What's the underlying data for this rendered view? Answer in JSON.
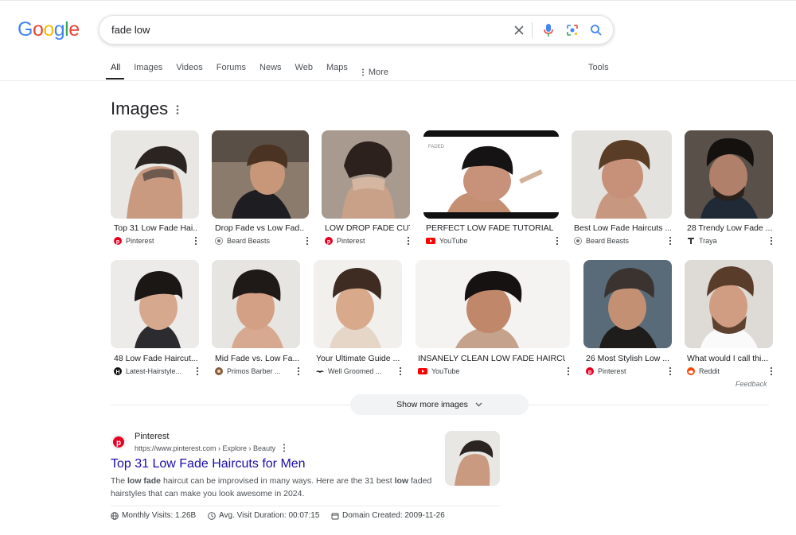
{
  "logo": {
    "text": "Google",
    "letters": [
      "G",
      "o",
      "o",
      "g",
      "l",
      "e"
    ],
    "colors": [
      "#4285F4",
      "#EA4335",
      "#FBBC05",
      "#4285F4",
      "#34A853",
      "#EA4335"
    ]
  },
  "search": {
    "query": "fade low"
  },
  "tabs": [
    "All",
    "Images",
    "Videos",
    "Forums",
    "News",
    "Web",
    "Maps",
    "More"
  ],
  "tools_label": "Tools",
  "images": {
    "title": "Images",
    "row1": [
      {
        "caption": "Top 31 Low Fade Hai...",
        "source": "Pinterest",
        "source_icon": "pinterest-icon"
      },
      {
        "caption": "Drop Fade vs Low Fad...",
        "source": "Beard Beasts",
        "source_icon": "beard-beasts-icon"
      },
      {
        "caption": "LOW DROP FADE CUT",
        "source": "Pinterest",
        "source_icon": "pinterest-icon"
      },
      {
        "caption": "PERFECT LOW FADE TUTORIAL, ...",
        "source": "YouTube",
        "source_icon": "youtube-icon"
      },
      {
        "caption": "Best Low Fade Haircuts ...",
        "source": "Beard Beasts",
        "source_icon": "beard-beasts-icon"
      },
      {
        "caption": "28 Trendy Low Fade ...",
        "source": "Traya",
        "source_icon": "traya-icon"
      }
    ],
    "row2": [
      {
        "caption": "48 Low Fade Haircut...",
        "source": "Latest-Hairstyle...",
        "source_icon": "latest-hairstyles-icon"
      },
      {
        "caption": "Mid Fade vs. Low Fa...",
        "source": "Primos Barber ...",
        "source_icon": "primos-barber-icon"
      },
      {
        "caption": "Your Ultimate Guide ...",
        "source": "Well Groomed ...",
        "source_icon": "well-groomed-icon"
      },
      {
        "caption": "INSANELY CLEAN LOW FADE HAIRCU...",
        "source": "YouTube",
        "source_icon": "youtube-icon"
      },
      {
        "caption": "26 Most Stylish Low ...",
        "source": "Pinterest",
        "source_icon": "pinterest-icon"
      },
      {
        "caption": "What would I call thi...",
        "source": "Reddit",
        "source_icon": "reddit-icon"
      }
    ],
    "faded_watermark": "FADED",
    "feedback": "Feedback",
    "show_more": "Show more images"
  },
  "result": {
    "site": "Pinterest",
    "url": "https://www.pinterest.com › Explore › Beauty",
    "title": "Top 31 Low Fade Haircuts for Men",
    "snippet_parts": [
      "The ",
      "low fade",
      " haircut can be improvised in many ways. Here are the 31 best ",
      "low",
      " faded hairstyles that can make you look awesome in 2024."
    ],
    "stats": [
      {
        "icon": "globe-icon",
        "text": "Monthly Visits: 1.26B"
      },
      {
        "icon": "clock-icon",
        "text": "Avg. Visit Duration: 00:07:15"
      },
      {
        "icon": "calendar-icon",
        "text": "Domain Created: 2009-11-26"
      }
    ]
  },
  "colors": {
    "link": "#1a0dab",
    "pinterest": "#E60023",
    "youtube": "#FF0000",
    "reddit": "#FF4500",
    "mic_blue": "#4285F4"
  }
}
